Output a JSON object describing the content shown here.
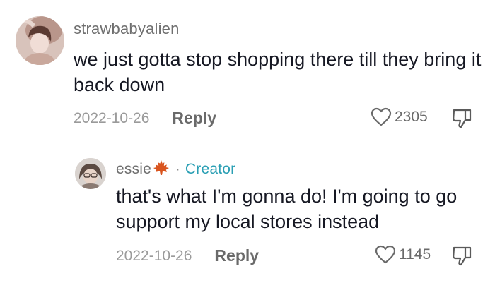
{
  "comments": [
    {
      "username": "strawbabyalien",
      "text": "we just gotta stop shopping there till they bring it back down",
      "date": "2022-10-26",
      "reply_label": "Reply",
      "likes": "2305",
      "avatar_icon": "user-avatar-photo"
    },
    {
      "username": "essie",
      "badge_icon": "maple-leaf-icon",
      "separator": "·",
      "creator_label": "Creator",
      "text": "that's what I'm gonna do! I'm going to go support my local stores instead",
      "date": "2022-10-26",
      "reply_label": "Reply",
      "likes": "1145",
      "avatar_icon": "user-avatar-photo"
    }
  ],
  "colors": {
    "creator_accent": "#2a9fb4",
    "text": "#161823",
    "muted": "#9a9a9a",
    "maple": "#d9541e"
  }
}
